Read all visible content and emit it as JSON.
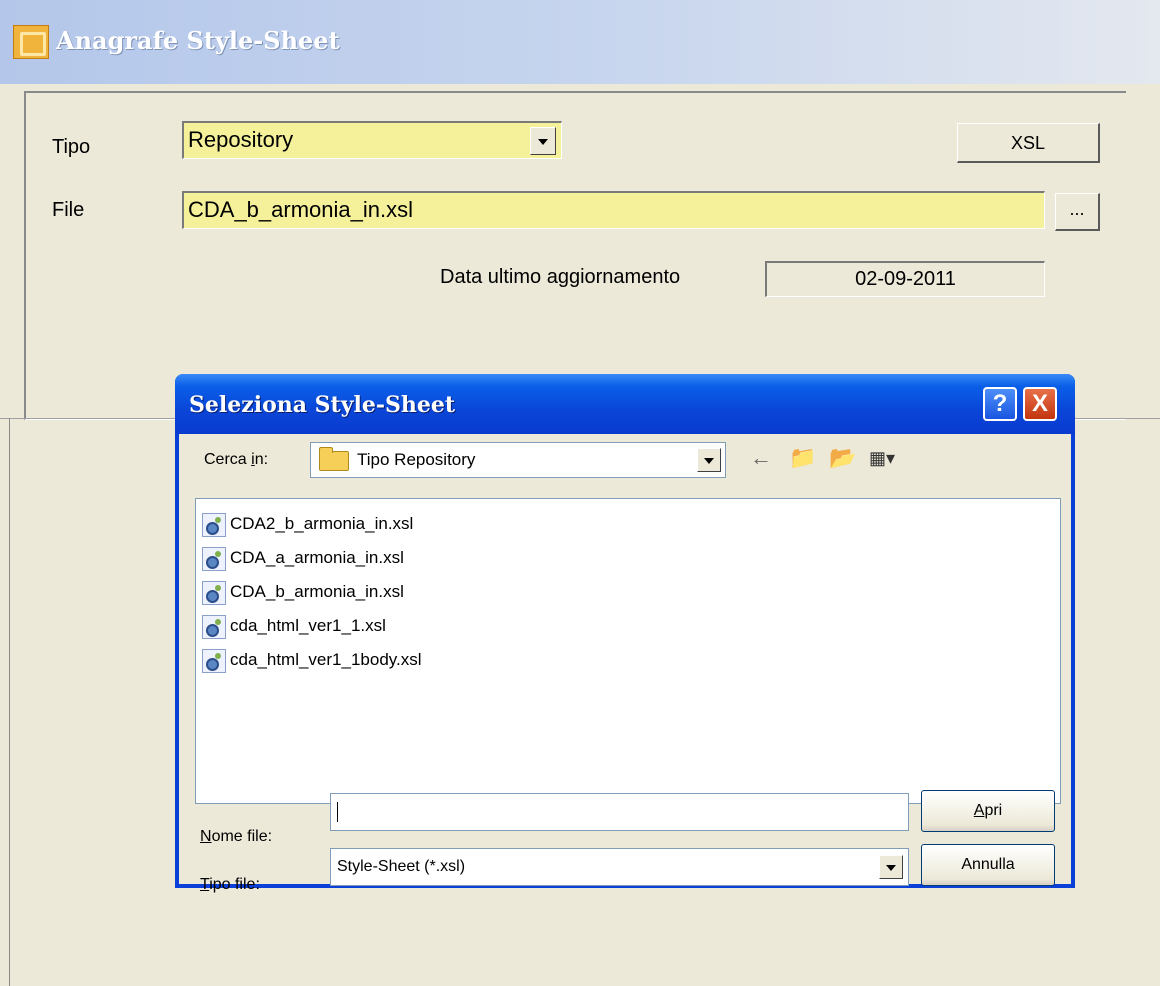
{
  "window": {
    "title": "Anagrafe Style-Sheet"
  },
  "form": {
    "tipo_label": "Tipo",
    "tipo_value": "Repository",
    "xsl_button": "XSL",
    "file_label": "File",
    "file_value": "CDA_b_armonia_in.xsl",
    "browse_button": "...",
    "date_label": "Data ultimo aggiornamento",
    "date_value": "02-09-2011"
  },
  "dialog": {
    "title": "Seleziona Style-Sheet",
    "help_button": "?",
    "close_button": "X",
    "look_in_label_pre": "Cerca ",
    "look_in_label_key": "i",
    "look_in_label_post": "n:",
    "look_in_value": "Tipo Repository",
    "toolbar_icons": [
      "back-arrow-icon",
      "up-folder-icon",
      "new-folder-icon",
      "view-menu-icon"
    ],
    "files": [
      "CDA2_b_armonia_in.xsl",
      "CDA_a_armonia_in.xsl",
      "CDA_b_armonia_in.xsl",
      "cda_html_ver1_1.xsl",
      "cda_html_ver1_1body.xsl"
    ],
    "filename_label_key": "N",
    "filename_label_rest": "ome file:",
    "filename_value": "",
    "filetype_label_key": "T",
    "filetype_label_rest": "ipo file:",
    "filetype_value": "Style-Sheet (*.xsl)",
    "open_button_key": "A",
    "open_button_rest": "pri",
    "cancel_button": "Annulla"
  }
}
